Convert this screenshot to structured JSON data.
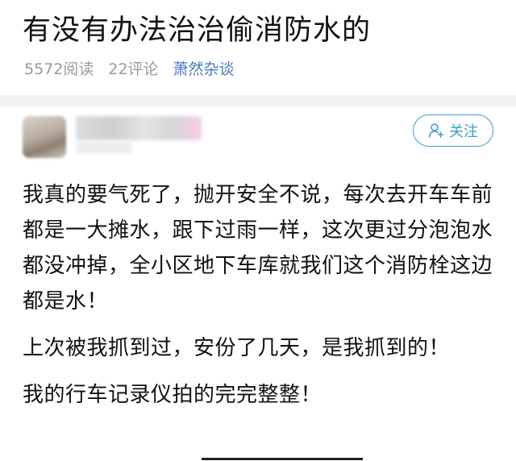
{
  "post": {
    "title": "有没有办法治治偷消防水的",
    "reads": "5572阅读",
    "comments": "22评论",
    "category": "萧然杂谈"
  },
  "author": {
    "follow_label": "关注"
  },
  "content": {
    "paragraphs": [
      "我真的要气死了，抛开安全不说，每次去开车车前都是一大摊水，跟下过雨一样，这次更过分泡泡水都没冲掉，全小区地下车库就我们这个消防栓这边都是水！",
      "上次被我抓到过，安份了几天，是我抓到的！",
      "我的行车记录仪拍的完完整整！"
    ]
  },
  "colors": {
    "accent": "#3d9cc8",
    "category": "#4a78c2",
    "meta": "#9a9a9a"
  },
  "icons": {
    "follow": "add-user-icon"
  }
}
